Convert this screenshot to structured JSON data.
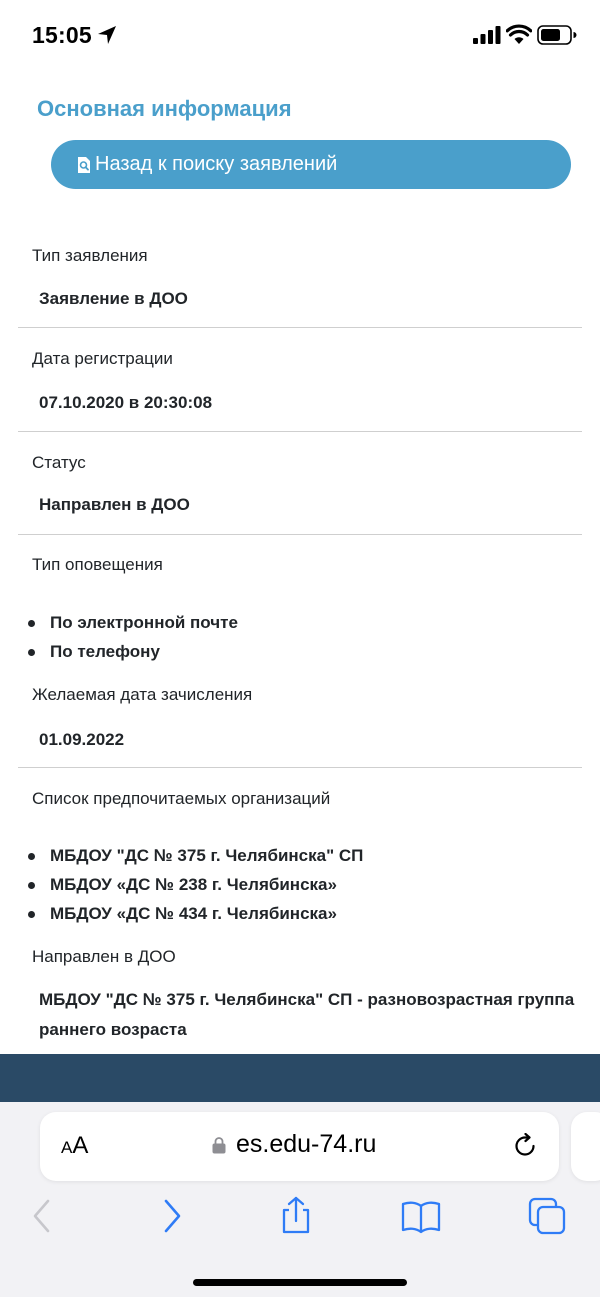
{
  "status_bar": {
    "time": "15:05"
  },
  "page": {
    "title": "Основная информация",
    "back_button": "Назад к поиску заявлений",
    "fields": {
      "type": {
        "label": "Тип заявления",
        "value": "Заявление в ДОО"
      },
      "reg_date": {
        "label": "Дата регистрации",
        "value": "07.10.2020 в 20:30:08"
      },
      "status": {
        "label": "Статус",
        "value": "Направлен в ДОО"
      },
      "notify": {
        "label": "Тип оповещения",
        "items": [
          "По электронной почте",
          "По телефону"
        ]
      },
      "enroll_date": {
        "label": "Желаемая дата зачисления",
        "value": "01.09.2022"
      },
      "orgs": {
        "label": "Список предпочитаемых организаций",
        "items": [
          "МБДОУ \"ДС № 375 г. Челябинска\" СП",
          "МБДОУ «ДС № 238 г. Челябинска»",
          "МБДОУ «ДС № 434 г. Челябинска»"
        ]
      },
      "directed": {
        "label": "Направлен в ДОО",
        "value": "МБДОУ \"ДС № 375 г. Челябинска\" СП - разновозрастная группа раннего возраста"
      }
    }
  },
  "browser": {
    "aa_small": "A",
    "aa_large": "A",
    "url": "es.edu-74.ru"
  },
  "colors": {
    "accent": "#4a9fcb",
    "footer": "#2a4a66",
    "ios_blue": "#2f7cf6"
  }
}
